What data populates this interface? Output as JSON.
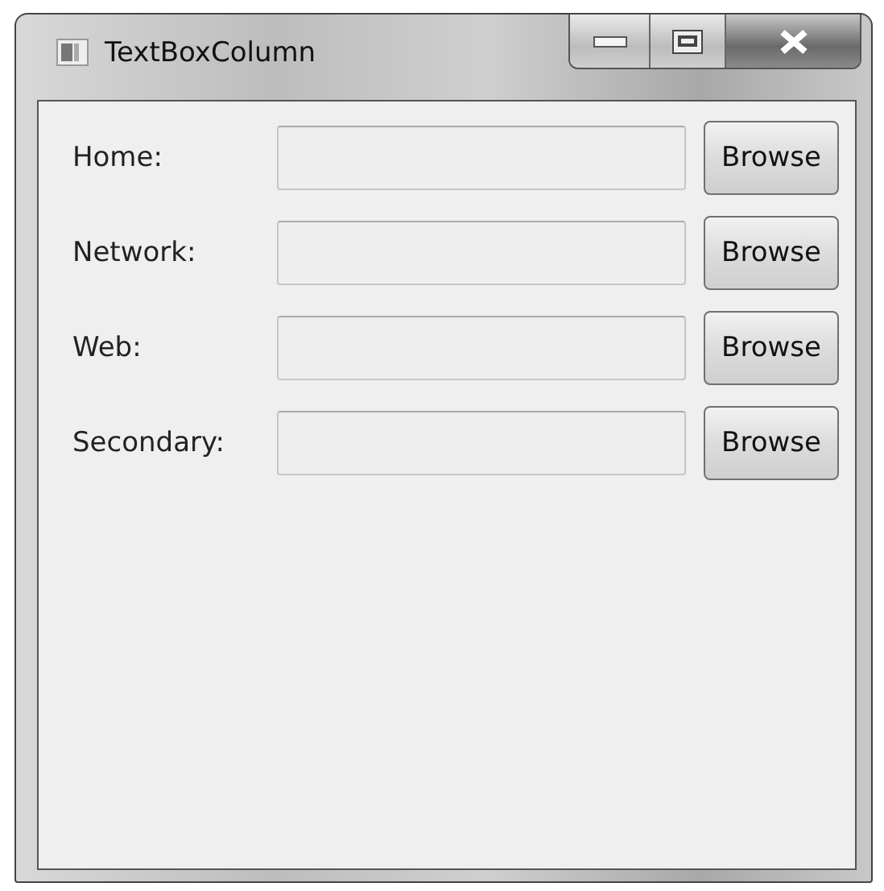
{
  "window": {
    "title": "TextBoxColumn"
  },
  "rows": [
    {
      "label": "Home:",
      "button": "Browse"
    },
    {
      "label": "Network:",
      "button": "Browse"
    },
    {
      "label": "Web:",
      "button": "Browse"
    },
    {
      "label": "Secondary:",
      "button": "Browse"
    }
  ]
}
